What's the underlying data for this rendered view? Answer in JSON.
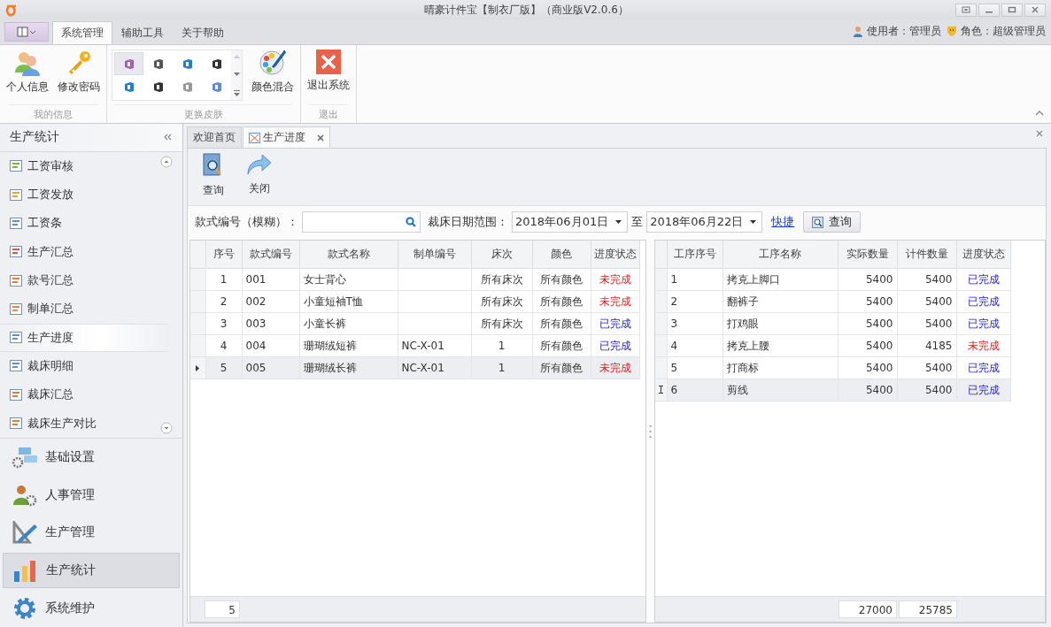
{
  "window": {
    "title": "晴豪计件宝【制衣厂版】（商业版V2.0.6）"
  },
  "ribbon": {
    "tabs": [
      {
        "label": "系统管理",
        "selected": true
      },
      {
        "label": "辅助工具",
        "selected": false
      },
      {
        "label": "关于帮助",
        "selected": false
      }
    ],
    "user_label": "使用者：管理员",
    "role_label": "角色：超级管理员",
    "info_group": {
      "label": "我的信息",
      "buttons": [
        "个人信息",
        "修改密码"
      ]
    },
    "skin_group": {
      "label": "更换皮肤",
      "skins": [
        {
          "selected": true
        },
        {
          "selected": false
        },
        {
          "selected": false
        },
        {
          "selected": false
        },
        {
          "selected": false
        },
        {
          "selected": false
        },
        {
          "selected": false
        },
        {
          "selected": false
        }
      ],
      "blend_button": "颜色混合"
    },
    "exit_group": {
      "label": "退出",
      "buttons": [
        "退出系统"
      ]
    }
  },
  "sidebar": {
    "title": "生产统计",
    "items": [
      {
        "label": "工资审核",
        "selected": false
      },
      {
        "label": "工资发放",
        "selected": false
      },
      {
        "label": "工资条",
        "selected": false
      },
      {
        "label": "生产汇总",
        "selected": false
      },
      {
        "label": "款号汇总",
        "selected": false
      },
      {
        "label": "制单汇总",
        "selected": false
      },
      {
        "label": "生产进度",
        "selected": true
      },
      {
        "label": "裁床明细",
        "selected": false
      },
      {
        "label": "裁床汇总",
        "selected": false
      },
      {
        "label": "裁床生产对比",
        "selected": false
      }
    ],
    "groups": [
      {
        "label": "基础设置",
        "selected": false
      },
      {
        "label": "人事管理",
        "selected": false
      },
      {
        "label": "生产管理",
        "selected": false
      },
      {
        "label": "生产统计",
        "selected": true
      },
      {
        "label": "系统维护",
        "selected": false
      }
    ]
  },
  "doc_tabs": [
    {
      "label": "欢迎首页",
      "selected": false,
      "closable": false
    },
    {
      "label": "生产进度",
      "selected": true,
      "closable": true
    }
  ],
  "toolbar": [
    "查询",
    "关闭"
  ],
  "filter": {
    "style_label": "款式编号（模糊）：",
    "date_label": "裁床日期范围：",
    "date_from": "2018年06月01日",
    "to_label": "至",
    "date_to": "2018年06月22日",
    "shortcut_link": "快捷",
    "query_button": "查询"
  },
  "orders_table": {
    "columns": [
      "序号",
      "款式编号",
      "款式名称",
      "制单编号",
      "床次",
      "颜色",
      "进度状态"
    ],
    "rows": [
      {
        "no": "1",
        "style_no": "001",
        "style_name": "女士背心",
        "bed": "所有床次",
        "color_name": "所有颜色",
        "status": "未完成",
        "done": false,
        "selected": false
      },
      {
        "no": "2",
        "style_no": "002",
        "style_name": "小童短袖T恤",
        "bed": "所有床次",
        "color_name": "所有颜色",
        "status": "未完成",
        "done": false,
        "selected": false
      },
      {
        "no": "3",
        "style_no": "003",
        "style_name": "小童长裤",
        "bed": "所有床次",
        "color_name": "所有颜色",
        "status": "已完成",
        "done": true,
        "selected": false
      },
      {
        "no": "4",
        "style_no": "004",
        "style_name": "珊瑚绒短裤",
        "order_no": "NC-X-01",
        "bed": "1",
        "color_name": "所有颜色",
        "status": "已完成",
        "done": true,
        "selected": false
      },
      {
        "no": "5",
        "style_no": "005",
        "style_name": "珊瑚绒长裤",
        "order_no": "NC-X-01",
        "bed": "1",
        "color_name": "所有颜色",
        "status": "未完成",
        "done": false,
        "selected": true
      }
    ],
    "footer": {
      "count": "5"
    }
  },
  "process_table": {
    "columns": [
      "工序序号",
      "工序名称",
      "实际数量",
      "计件数量",
      "进度状态"
    ],
    "rows": [
      {
        "step": "1",
        "name": "拷克上脚口",
        "actual": "5400",
        "piece": "5400",
        "status": "已完成",
        "done": true,
        "selected": false
      },
      {
        "step": "2",
        "name": "翻裤子",
        "actual": "5400",
        "piece": "5400",
        "status": "已完成",
        "done": true,
        "selected": false
      },
      {
        "step": "3",
        "name": "打鸡眼",
        "actual": "5400",
        "piece": "5400",
        "status": "已完成",
        "done": true,
        "selected": false
      },
      {
        "step": "4",
        "name": "拷克上腰",
        "actual": "5400",
        "piece": "4185",
        "status": "未完成",
        "done": false,
        "selected": false
      },
      {
        "step": "5",
        "name": "打商标",
        "actual": "5400",
        "piece": "5400",
        "status": "已完成",
        "done": true,
        "selected": false
      },
      {
        "step": "6",
        "name": "剪线",
        "actual": "5400",
        "piece": "5400",
        "status": "已完成",
        "done": true,
        "selected": true,
        "editing": true
      }
    ],
    "footer": {
      "actual_total": "27000",
      "piece_total": "25785"
    }
  }
}
